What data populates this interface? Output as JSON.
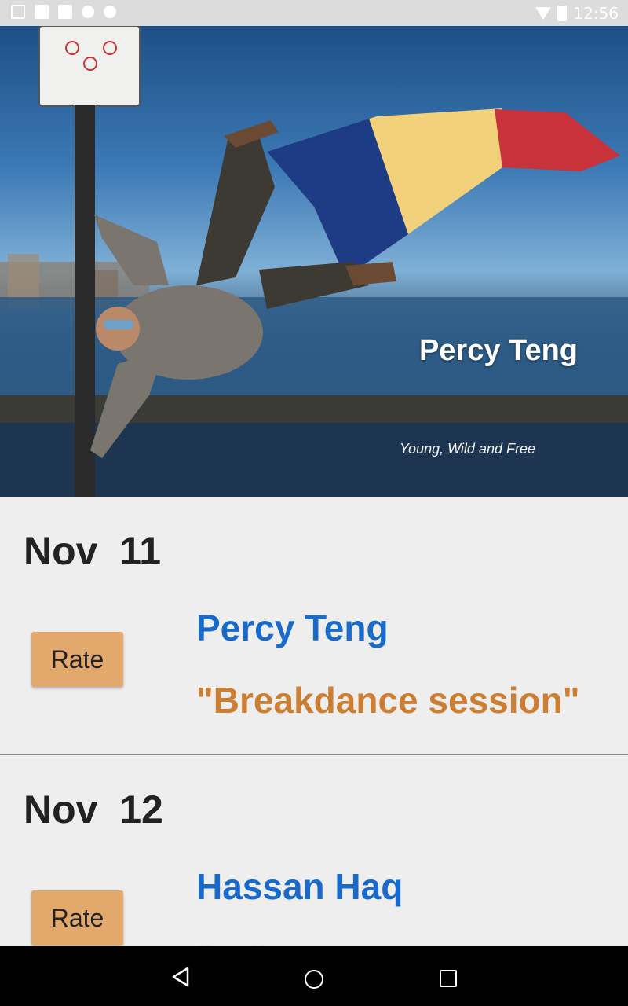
{
  "status_bar": {
    "time": "12:56",
    "left_icons": [
      "image-icon",
      "notification-icon",
      "notification-icon",
      "android-icon",
      "android-icon"
    ],
    "right_icons": [
      "wifi-icon",
      "battery-icon"
    ]
  },
  "hero": {
    "name": "Percy Teng",
    "tagline": "Young, Wild and Free"
  },
  "entries": [
    {
      "date": "Nov  11",
      "rate_label": "Rate",
      "name": "Percy Teng",
      "title": "\"Breakdance session\""
    },
    {
      "date": "Nov  12",
      "rate_label": "Rate",
      "name": "Hassan Haq",
      "title": "\"…\""
    }
  ],
  "nav": {
    "icons": [
      "back-icon",
      "home-icon",
      "recents-icon"
    ]
  },
  "colors": {
    "name_blue": "#1a6bc9",
    "title_orange": "#cc7f32",
    "rate_button": "#e3a86c",
    "background": "#eeeeee"
  }
}
